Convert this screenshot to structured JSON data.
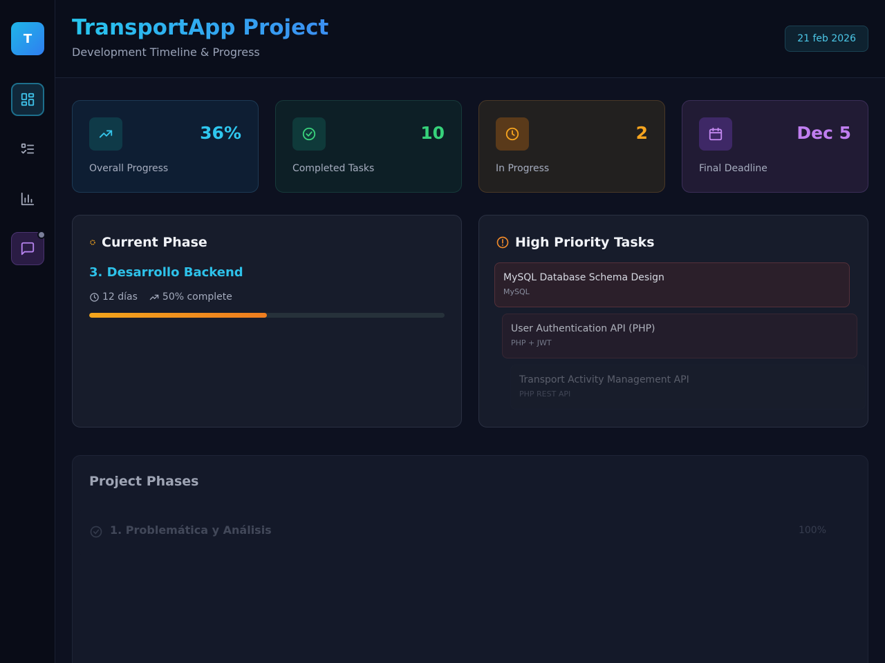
{
  "sidebar": {
    "logo_letter": "T",
    "items": [
      {
        "name": "dashboard",
        "icon": "grid-icon",
        "active": true
      },
      {
        "name": "tasks",
        "icon": "checklist-icon",
        "active": false
      },
      {
        "name": "analytics",
        "icon": "bar-chart-icon",
        "active": false
      },
      {
        "name": "chat",
        "icon": "chat-icon",
        "active": false
      }
    ]
  },
  "header": {
    "title": "TransportApp Project",
    "subtitle": "Development Timeline & Progress",
    "date": "21 feb 2026"
  },
  "stats": [
    {
      "icon": "trending-up-icon",
      "value": "36%",
      "label": "Overall Progress",
      "color": "#2fc7ef"
    },
    {
      "icon": "check-circle-icon",
      "value": "10",
      "label": "Completed Tasks",
      "color": "#36d17a"
    },
    {
      "icon": "clock-icon",
      "value": "2",
      "label": "In Progress",
      "color": "#f6a41f"
    },
    {
      "icon": "calendar-icon",
      "value": "Dec 5",
      "label": "Final Deadline",
      "color": "#c07ef0"
    }
  ],
  "current_phase": {
    "title": "Current Phase",
    "phase_name": "3. Desarrollo Backend",
    "duration": "12 días",
    "progress_text": "50% complete",
    "progress": 0.5
  },
  "high_priority": {
    "title": "High Priority Tasks",
    "tasks": [
      {
        "title": "MySQL Database Schema Design",
        "tech": "MySQL"
      },
      {
        "title": "User Authentication API (PHP)",
        "tech": "PHP + JWT"
      },
      {
        "title": "Transport Activity Management API",
        "tech": "PHP REST API"
      }
    ]
  },
  "project_phases": {
    "title": "Project Phases",
    "items": [
      {
        "name": "1. Problemática y Análisis",
        "percent": "100%"
      }
    ]
  }
}
